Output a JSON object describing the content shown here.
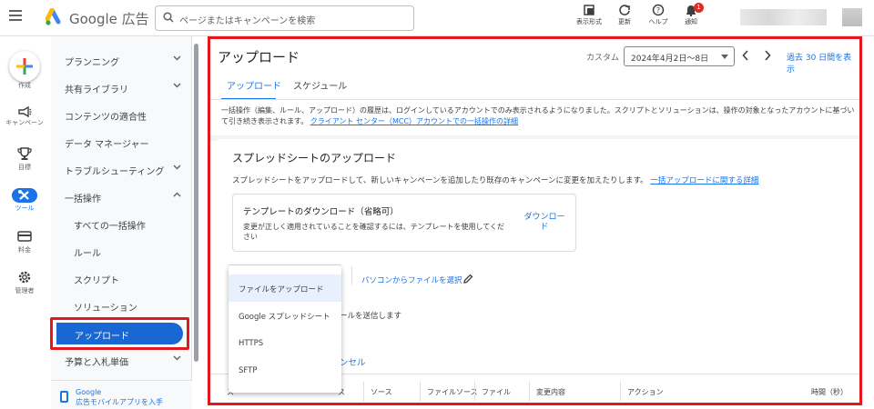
{
  "topbar": {
    "brand": "Google 広告",
    "search_placeholder": "ページまたはキャンペーンを検索",
    "icons": [
      {
        "icon": "display-format-icon",
        "label": "表示形式"
      },
      {
        "icon": "refresh-icon",
        "label": "更新"
      },
      {
        "icon": "help-icon",
        "label": "ヘルプ"
      },
      {
        "icon": "bell-icon",
        "label": "通知",
        "badge": "1"
      }
    ]
  },
  "rail": {
    "create_label": "作成",
    "items": [
      {
        "icon": "megaphone-icon",
        "label": "キャンペーン"
      },
      {
        "icon": "trophy-icon",
        "label": "目標"
      },
      {
        "icon": "tools-icon",
        "label": "ツール"
      },
      {
        "icon": "billing-icon",
        "label": "料金"
      },
      {
        "icon": "gear-icon",
        "label": "管理者"
      }
    ]
  },
  "sidebar": {
    "items": [
      {
        "label": "プランニング",
        "chevron": "down"
      },
      {
        "label": "共有ライブラリ",
        "chevron": "down"
      },
      {
        "label": "コンテンツの適合性"
      },
      {
        "label": "データ マネージャー"
      },
      {
        "label": "トラブルシューティング",
        "chevron": "down"
      },
      {
        "label": "一括操作",
        "chevron": "up"
      }
    ],
    "sub_items": [
      "すべての一括操作",
      "ルール",
      "スクリプト",
      "ソリューション"
    ],
    "active_item": "アップロード",
    "after_items": [
      {
        "label": "予算と入札単価",
        "chevron": "down"
      }
    ],
    "mobile_line1": "Google",
    "mobile_line2": "広告モバイルアプリを入手"
  },
  "main": {
    "title": "アップロード",
    "custom_label": "カスタム",
    "date_range": "2024年4月2日〜8日",
    "past_30": "過去 30 日間を表示",
    "tabs": [
      "アップロード",
      "スケジュール"
    ],
    "notice": "一括操作（編集、ルール、アップロード）の履歴は、ログインしているアカウントでのみ表示されるようになりました。スクリプトとソリューションは、操作の対象となったアカウントに基づいて引き続き表示されます。",
    "notice_link": "クライアント センター（MCC）アカウントでの一括操作の詳細",
    "card": {
      "title": "スプレッドシートのアップロード",
      "desc": "スプレッドシートをアップロードして、新しいキャンペーンを追加したり既存のキャンペーンに変更を加えたりします。",
      "desc_link": "一括アップロードに関する詳細",
      "template_title": "テンプレートのダウンロード（省略可）",
      "template_body": "変更が正しく適用されていることを確認するには、テンプレートを使用してください",
      "download_label": "ダウンロード",
      "pick_file": "パソコンからファイルを選択",
      "send_text": "ールを送信します",
      "cancel": "ンセル"
    },
    "table_headers": [
      "ス",
      "ソース",
      "ファイルソース",
      "ファイル",
      "変更内容",
      "アクション",
      "時間（秒）"
    ]
  },
  "menu": {
    "items": [
      "ファイルをアップロード",
      "Google スプレッドシート",
      "HTTPS",
      "SFTP"
    ],
    "selected": 0
  },
  "colors": {
    "accent": "#1a73e8",
    "highlight_border": "#e3181f",
    "active_nav": "#1967d2"
  }
}
